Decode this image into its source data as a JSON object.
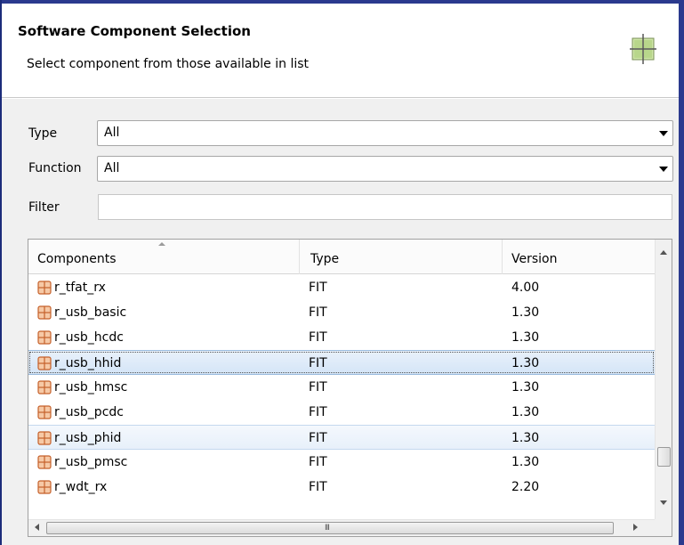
{
  "header": {
    "title": "Software Component Selection",
    "subtitle": "Select component from those available in list",
    "icon": "component-grid-icon"
  },
  "form": {
    "type_label": "Type",
    "type_value": "All",
    "function_label": "Function",
    "function_value": "All",
    "filter_label": "Filter",
    "filter_value": ""
  },
  "table": {
    "columns": [
      "Components",
      "Type",
      "Version"
    ],
    "sort_column": "Components",
    "rows": [
      {
        "name": "r_tfat_rx",
        "type": "FIT",
        "version": "4.00",
        "state": "normal"
      },
      {
        "name": "r_usb_basic",
        "type": "FIT",
        "version": "1.30",
        "state": "normal"
      },
      {
        "name": "r_usb_hcdc",
        "type": "FIT",
        "version": "1.30",
        "state": "normal"
      },
      {
        "name": "r_usb_hhid",
        "type": "FIT",
        "version": "1.30",
        "state": "selected"
      },
      {
        "name": "r_usb_hmsc",
        "type": "FIT",
        "version": "1.30",
        "state": "normal"
      },
      {
        "name": "r_usb_pcdc",
        "type": "FIT",
        "version": "1.30",
        "state": "normal"
      },
      {
        "name": "r_usb_phid",
        "type": "FIT",
        "version": "1.30",
        "state": "hover"
      },
      {
        "name": "r_usb_pmsc",
        "type": "FIT",
        "version": "1.30",
        "state": "normal"
      },
      {
        "name": "r_wdt_rx",
        "type": "FIT",
        "version": "2.20",
        "state": "normal"
      }
    ]
  },
  "colors": {
    "frame": "#2b3a8e",
    "icon_orange": "#d2691e",
    "selection": "#d4e5f7"
  }
}
